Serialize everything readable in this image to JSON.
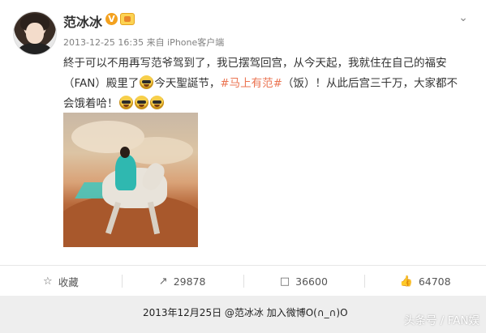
{
  "post": {
    "username": "范冰冰",
    "verified_badge": "V",
    "timestamp": "2013-12-25 16:35",
    "source_prefix": "来自",
    "source": "iPhone客户端",
    "text": {
      "line1": "終于可以不用再写范爷驾到了，我已摆驾回宫，从今天起，我就住在自己的福安",
      "line2a": "（FAN）殿里了",
      "line2b": "今天聖誕节，",
      "topic": "#马上有范#",
      "line2c": "（饭）！从此后宫三千万，大家都不",
      "line3": "会饿着哈！"
    }
  },
  "actions": {
    "favorite": {
      "icon": "star-icon",
      "label": "收藏"
    },
    "repost": {
      "icon": "share-icon",
      "count": "29878"
    },
    "comment": {
      "icon": "comment-icon",
      "count": "36600"
    },
    "like": {
      "icon": "thumbs-up-icon",
      "count": "64708"
    }
  },
  "footer": {
    "caption": "2013年12月25日 @范冰冰 加入微博O(∩_∩)O",
    "watermark": "头条号 / FAN娱"
  },
  "colors": {
    "topic": "#eb7350",
    "badge_orange": "#f3a11f",
    "footer_bg": "#eeeeee"
  }
}
